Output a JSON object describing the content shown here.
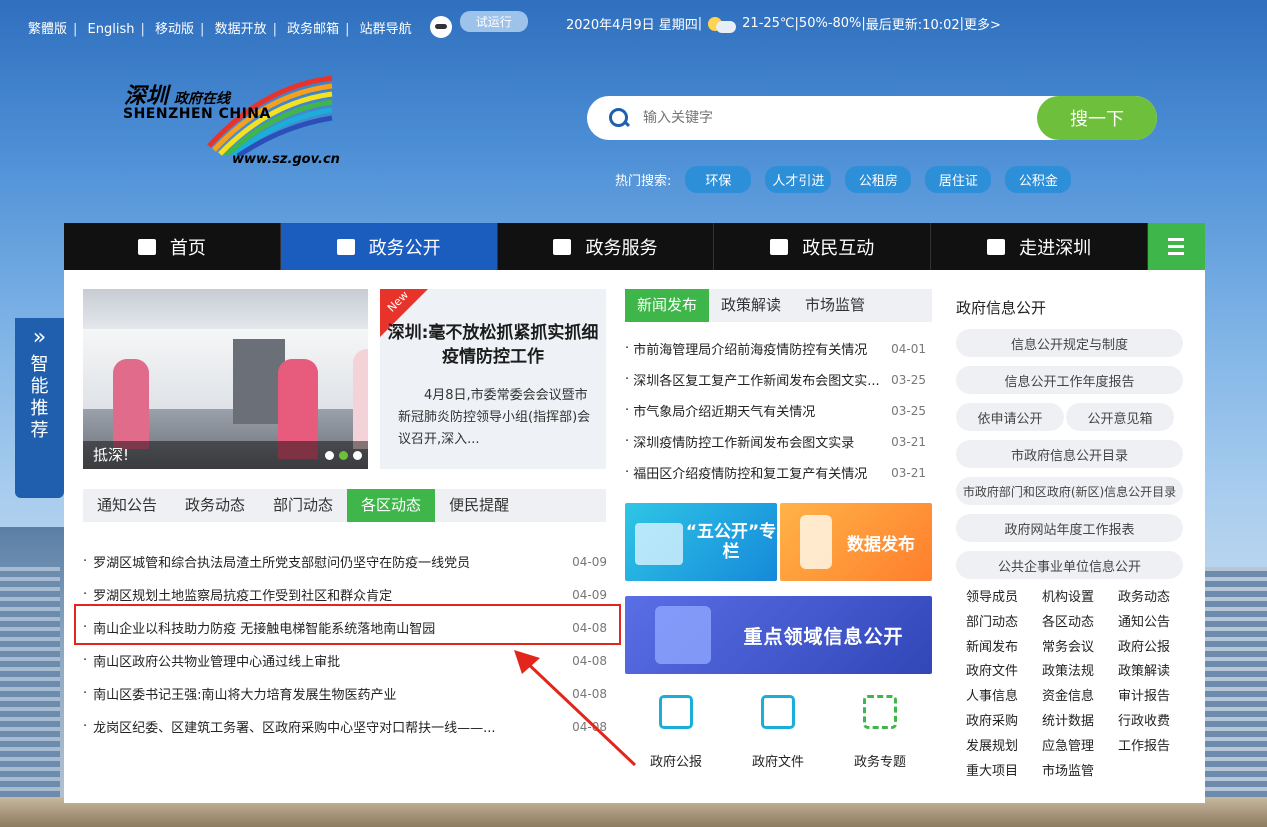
{
  "topbar": {
    "links": [
      "繁體版",
      "English",
      "移动版",
      "数据开放",
      "政务邮箱",
      "站群导航"
    ],
    "trial": "试运行",
    "date": "2020年4月9日 星期四",
    "weather": "21-25℃",
    "humidity": "50%-80%",
    "updated": "最后更新:10:02",
    "more": "更多>"
  },
  "logo": {
    "cn": "深圳",
    "cn_sub": "政府在线",
    "en": "SHENZHEN CHINA",
    "url": "www.sz.gov.cn"
  },
  "search": {
    "placeholder": "输入关键字",
    "button": "搜一下",
    "hot_label": "热门搜索:",
    "hot": [
      "环保",
      "人才引进",
      "公租房",
      "居住证",
      "公积金"
    ]
  },
  "nav": [
    "首页",
    "政务公开",
    "政务服务",
    "政民互动",
    "走进深圳"
  ],
  "side": {
    "arrow": "»",
    "text": "智能推荐"
  },
  "slider": {
    "caption": "抵深!",
    "new": "New",
    "title": "深圳:毫不放松抓紧抓实抓细疫情防控工作",
    "summary": "4月8日,市委常委会会议暨市新冠肺炎防控领导小组(指挥部)会议召开,深入..."
  },
  "left_tabs": [
    "通知公告",
    "政务动态",
    "部门动态",
    "各区动态",
    "便民提醒"
  ],
  "left_list": [
    {
      "title": "罗湖区城管和综合执法局渣土所党支部慰问仍坚守在防疫一线党员",
      "date": "04-09"
    },
    {
      "title": "罗湖区规划土地监察局抗疫工作受到社区和群众肯定",
      "date": "04-09"
    },
    {
      "title": "南山企业以科技助力防疫 无接触电梯智能系统落地南山智园",
      "date": "04-08"
    },
    {
      "title": "南山区政府公共物业管理中心通过线上审批",
      "date": "04-08"
    },
    {
      "title": "南山区委书记王强:南山将大力培育发展生物医药产业",
      "date": "04-08"
    },
    {
      "title": "龙岗区纪委、区建筑工务署、区政府采购中心坚守对口帮扶一线——...",
      "date": "04-08"
    }
  ],
  "mid_tabs": [
    "新闻发布",
    "政策解读",
    "市场监管"
  ],
  "mid_list": [
    {
      "title": "市前海管理局介绍前海疫情防控有关情况",
      "date": "04-01"
    },
    {
      "title": "深圳各区复工复产工作新闻发布会图文实...",
      "date": "03-25"
    },
    {
      "title": "市气象局介绍近期天气有关情况",
      "date": "03-25"
    },
    {
      "title": "深圳疫情防控工作新闻发布会图文实录",
      "date": "03-21"
    },
    {
      "title": "福田区介绍疫情防控和复工复产有关情况",
      "date": "03-21"
    }
  ],
  "banners": {
    "b1": "“五公开”专栏",
    "b2": "数据发布",
    "b3": "重点领域信息公开"
  },
  "quick": [
    "政府公报",
    "政府文件",
    "政务专题"
  ],
  "right": {
    "title": "政府信息公开",
    "pills": [
      "信息公开规定与制度",
      "信息公开工作年度报告",
      "依申请公开",
      "公开意见箱",
      "市政府信息公开目录",
      "市政府部门和区政府(新区)信息公开目录",
      "政府网站年度工作报表",
      "公共企事业单位信息公开"
    ],
    "grid": [
      "领导成员",
      "机构设置",
      "政务动态",
      "部门动态",
      "各区动态",
      "通知公告",
      "新闻发布",
      "常务会议",
      "政府公报",
      "政府文件",
      "政策法规",
      "政策解读",
      "人事信息",
      "资金信息",
      "审计报告",
      "政府采购",
      "统计数据",
      "行政收费",
      "发展规划",
      "应急管理",
      "工作报告",
      "重大项目",
      "市场监管"
    ]
  }
}
